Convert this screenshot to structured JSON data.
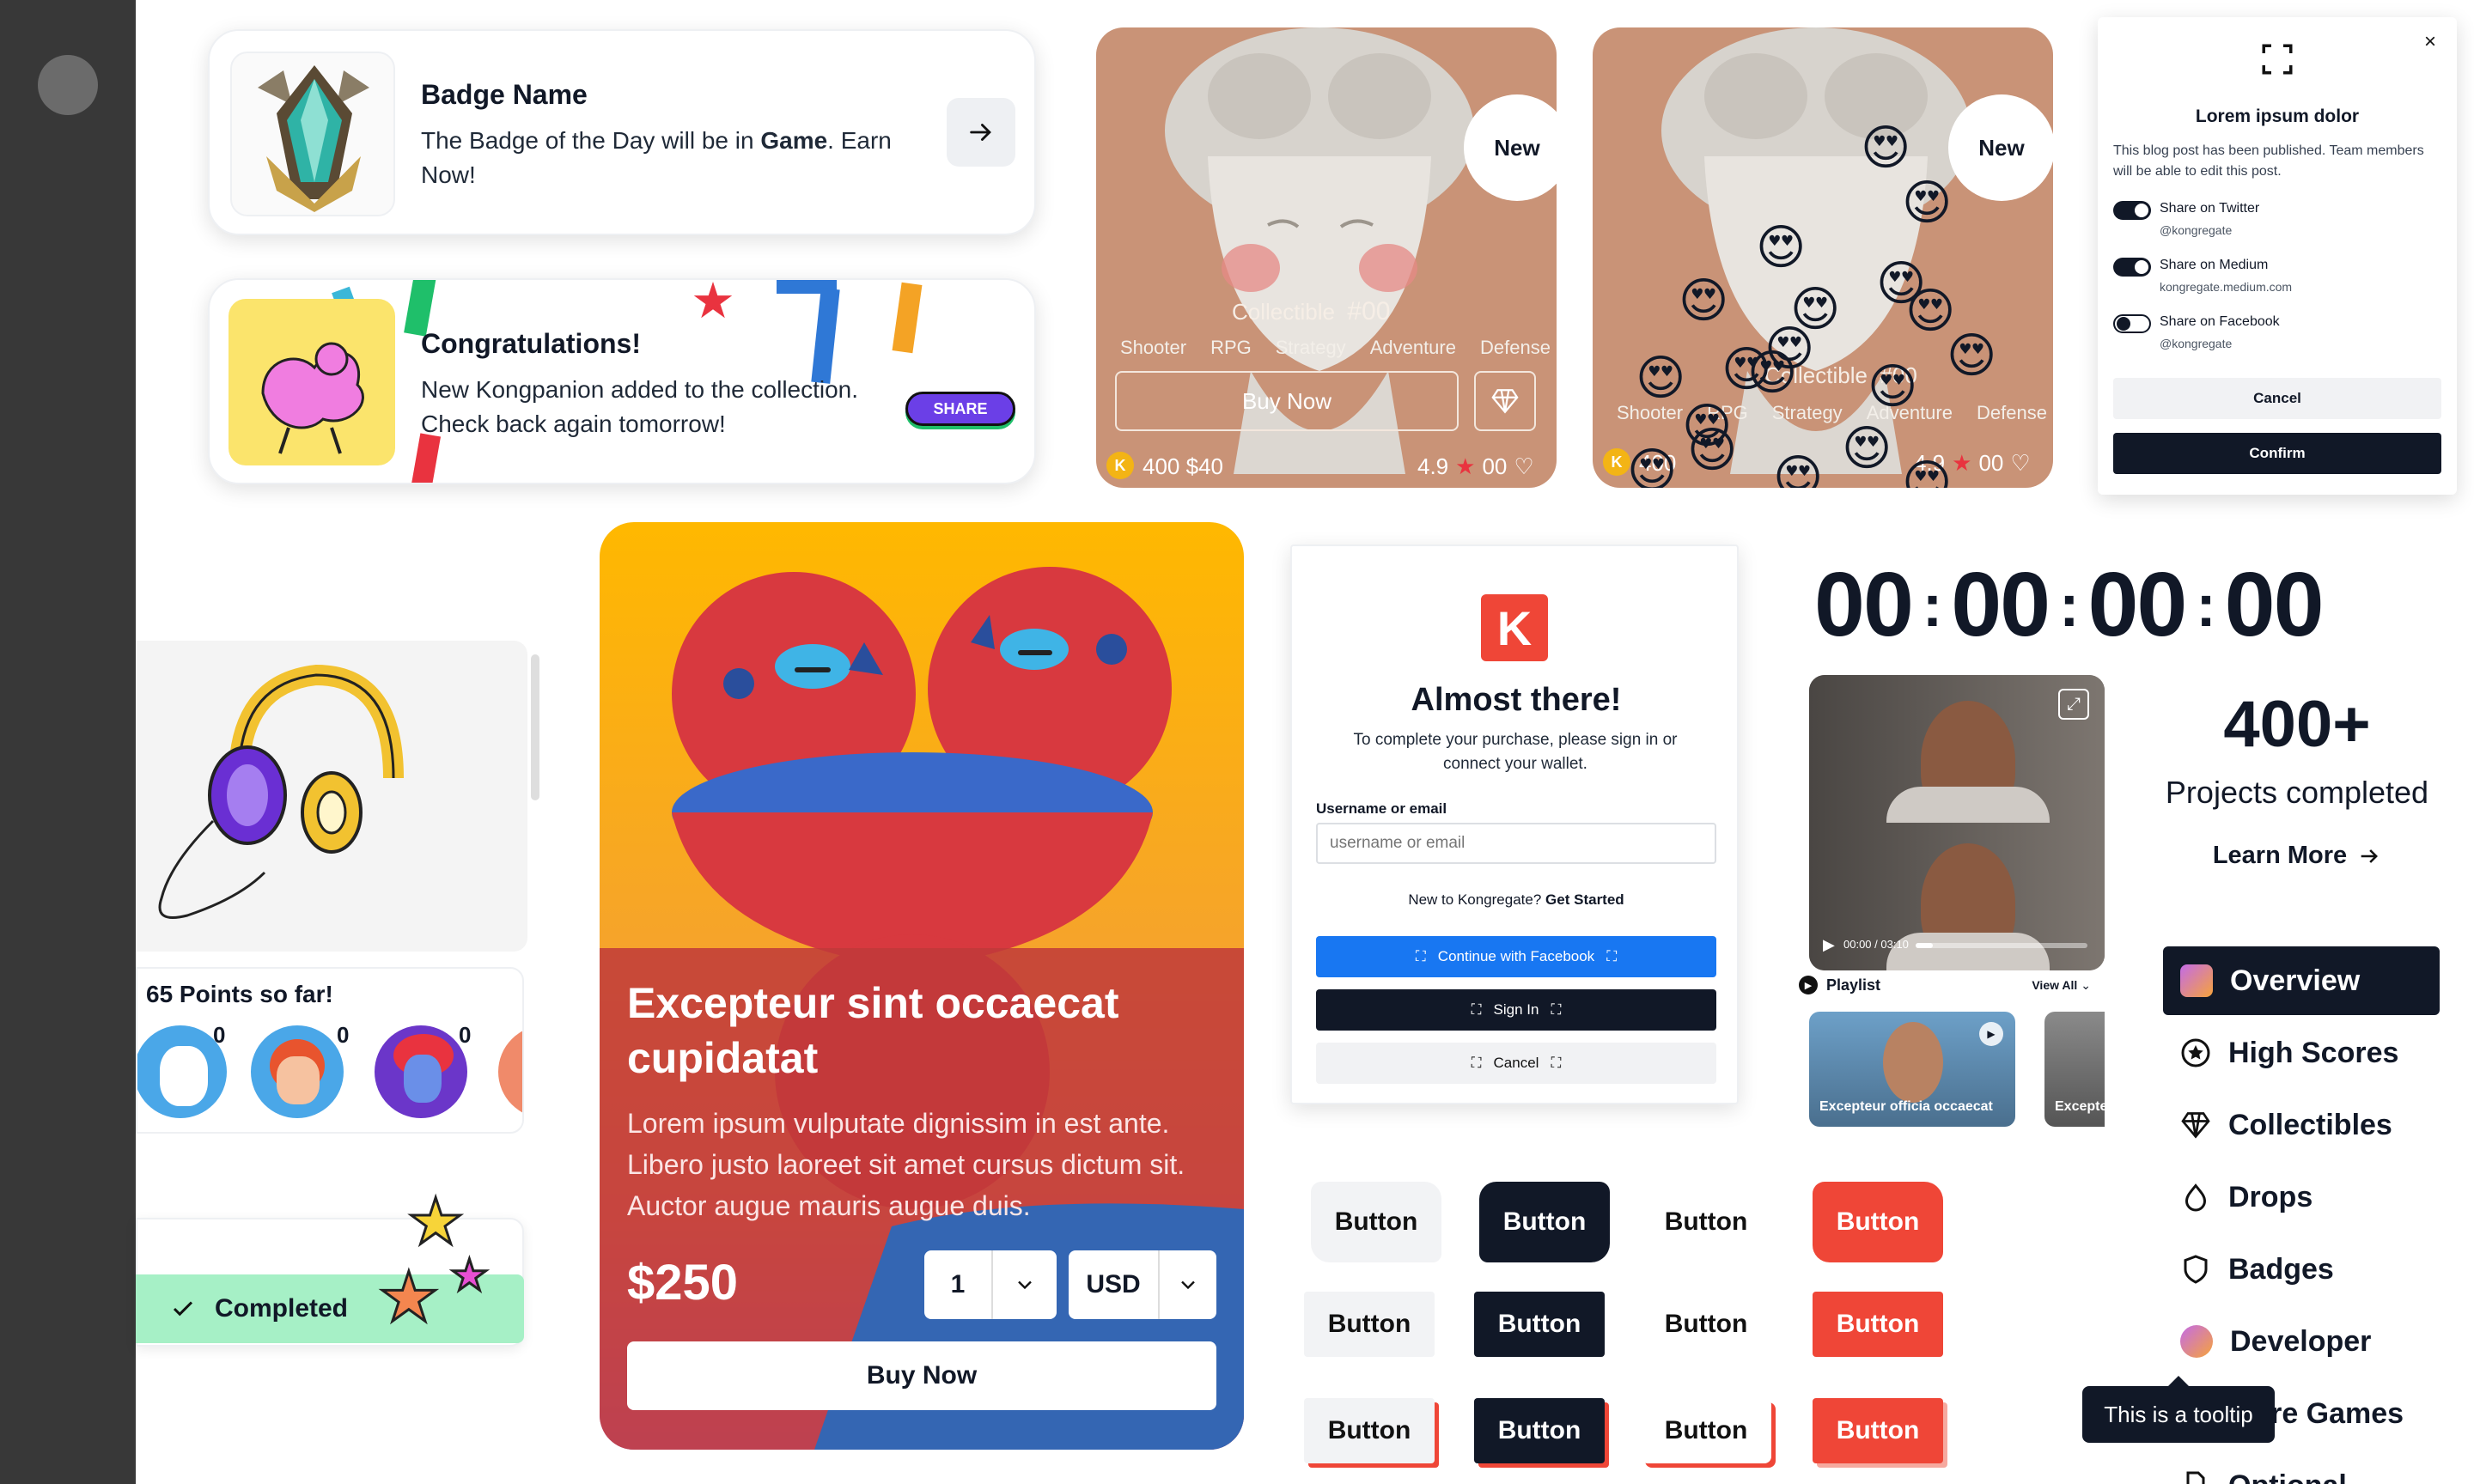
{
  "colors": {
    "dark": "#111827",
    "red": "#EF4637",
    "blue": "#1877F2",
    "green": "#A6F0C6",
    "peach": "#C99377",
    "purple": "#6B3FE7",
    "sidebar": "#3A3A3A"
  },
  "badge_card": {
    "title": "Badge Name",
    "text_before": "The Badge of the Day will be in ",
    "text_bold": "Game",
    "text_after": ". Earn Now!",
    "arrow_icon": "arrow-right-icon"
  },
  "congrats_card": {
    "title": "Congratulations!",
    "text": "New Kongpanion added to the collection. Check back again tomorrow!",
    "share_label": "SHARE"
  },
  "product_card_1": {
    "badge": "New",
    "collectible_label": "Collectible",
    "collectible_number": "#00",
    "tags": [
      "Shooter",
      "RPG",
      "Strategy",
      "Adventure",
      "Defense"
    ],
    "buy_label": "Buy Now",
    "price_coins": "400",
    "price_usd": "$40",
    "rating": "4.9",
    "likes": "00"
  },
  "product_card_2": {
    "badge": "New",
    "collectible_label": "Collectible",
    "collectible_number": "#00",
    "tags": [
      "Shooter",
      "RPG",
      "Strategy",
      "Adventure",
      "Defense"
    ],
    "price_coins": "400",
    "rating": "4.9",
    "likes": "00"
  },
  "share_modal": {
    "title": "Lorem ipsum dolor",
    "description": "This blog post has been published. Team members will be able to edit this post.",
    "options": [
      {
        "label": "Share on Twitter",
        "handle": "@kongregate",
        "enabled": true
      },
      {
        "label": "Share on Medium",
        "handle": "kongregate.medium.com",
        "enabled": true
      },
      {
        "label": "Share on Facebook",
        "handle": "@kongregate",
        "enabled": false
      }
    ],
    "cancel_label": "Cancel",
    "confirm_label": "Confirm"
  },
  "points_panel": {
    "text": "65 Points so far!",
    "avatar_counts": [
      "0",
      "0",
      "0"
    ],
    "completed_label": "Completed"
  },
  "promo_card": {
    "title": "Excepteur sint occaecat cupidatat",
    "body": "Lorem ipsum vulputate dignissim in est ante. Libero justo laoreet sit amet cursus dictum sit. Auctor augue mauris augue duis.",
    "price": "$250",
    "quantity": "1",
    "currency": "USD",
    "buy_label": "Buy Now"
  },
  "login_card": {
    "logo_letter": "K",
    "title": "Almost there!",
    "subtitle": "To complete your purchase, please sign in or connect your wallet.",
    "field_label": "Username or email",
    "field_placeholder": "username or email",
    "new_text": "New to Kongregate?",
    "get_started": "Get Started",
    "facebook_label": "Continue with Facebook",
    "signin_label": "Sign In",
    "cancel_label": "Cancel"
  },
  "countdown": {
    "values": [
      "00",
      "00",
      "00",
      "00"
    ]
  },
  "video_player": {
    "time": "00:00 / 03:10",
    "playlist_label": "Playlist",
    "view_all": "View All",
    "thumbs": [
      "Excepteur officia occaecat",
      "Excepteur"
    ]
  },
  "stats": {
    "number": "400+",
    "label": "Projects completed",
    "link": "Learn More"
  },
  "button_grid": {
    "label": "Button"
  },
  "side_menu": {
    "items": [
      {
        "label": "Overview",
        "icon": "avatar-icon"
      },
      {
        "label": "High Scores",
        "icon": "star-icon"
      },
      {
        "label": "Collectibles",
        "icon": "diamond-icon"
      },
      {
        "label": "Drops",
        "icon": "drop-icon"
      },
      {
        "label": "Badges",
        "icon": "shield-icon"
      },
      {
        "label": "Developer",
        "icon": "avatar-icon"
      },
      {
        "label": "More Games",
        "icon": "gamepad-icon"
      },
      {
        "label": "Optional",
        "icon": "file-icon"
      }
    ]
  },
  "tooltip": {
    "text": "This is a tooltip"
  }
}
